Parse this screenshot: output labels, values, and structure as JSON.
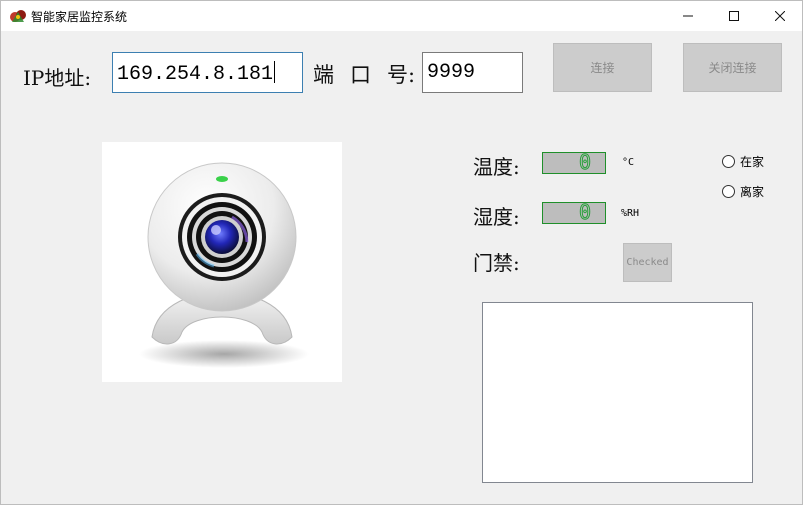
{
  "window": {
    "title": "智能家居监控系统",
    "controls": {
      "minimize": "—",
      "maximize": "☐",
      "close": "✕"
    }
  },
  "connection": {
    "ip_label": "IP地址:",
    "ip_value": "169.254.8.181",
    "port_label_parts": [
      "端",
      "口",
      "号:"
    ],
    "port_value": "9999",
    "connect_button": "连接",
    "disconnect_button": "关闭连接"
  },
  "sensors": {
    "temperature_label": "温度:",
    "temperature_value": "0",
    "temperature_unit": "°C",
    "humidity_label": "湿度:",
    "humidity_value": "0",
    "humidity_unit": "%RH",
    "door_label": "门禁:",
    "door_button": "Checked"
  },
  "mode": {
    "options": [
      "在家",
      "离家"
    ],
    "selected": null
  },
  "log": {
    "content": ""
  },
  "icons": {
    "app": "app-logo-icon",
    "camera": "webcam-image"
  },
  "colors": {
    "titlebar": "#ffffff",
    "background": "#f0f0f0",
    "lcd_border": "#1f8f2a",
    "input_focus_border": "#3c7fb1"
  }
}
